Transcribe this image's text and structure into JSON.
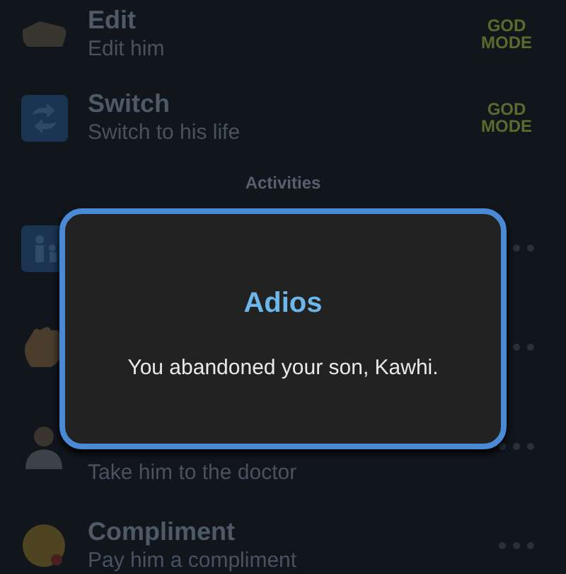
{
  "actions": [
    {
      "title": "Edit",
      "subtitle": "Edit him",
      "badge": "GOD MODE"
    },
    {
      "title": "Switch",
      "subtitle": "Switch to his life",
      "badge": "GOD MODE"
    }
  ],
  "section_header": "Activities",
  "activities": [
    {
      "kind": "family"
    },
    {
      "kind": "wave"
    },
    {
      "kind": "doctor",
      "subtitle": "Take him to the doctor"
    },
    {
      "kind": "kiss",
      "title": "Compliment",
      "subtitle": "Pay him a compliment"
    }
  ],
  "dialog": {
    "title": "Adios",
    "message": "You abandoned your son, Kawhi."
  }
}
